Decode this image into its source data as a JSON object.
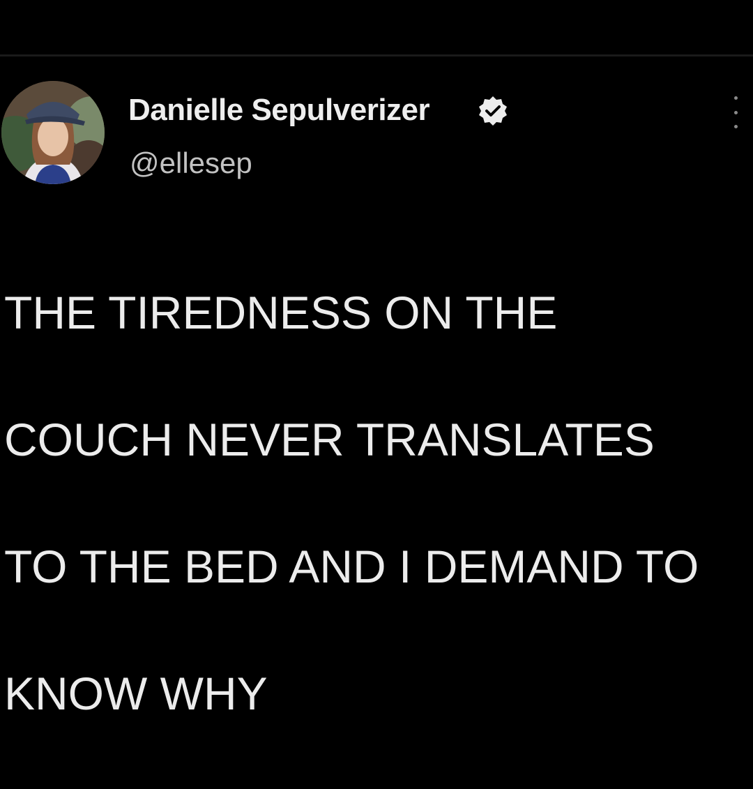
{
  "author": {
    "display_name": "Danielle Sepulverizer",
    "handle": "@ellesep",
    "verified": true,
    "avatar_icon": "profile-photo"
  },
  "tweet": {
    "text_lines": [
      "THE TIREDNESS ON THE",
      "COUCH NEVER TRANSLATES",
      "TO THE BED AND I DEMAND TO",
      "KNOW WHY"
    ]
  },
  "icons": {
    "verified": "verified-badge-icon",
    "more": "more-options-icon"
  },
  "colors": {
    "background": "#000000",
    "text": "#ececec",
    "handle": "#c2c2c2"
  }
}
